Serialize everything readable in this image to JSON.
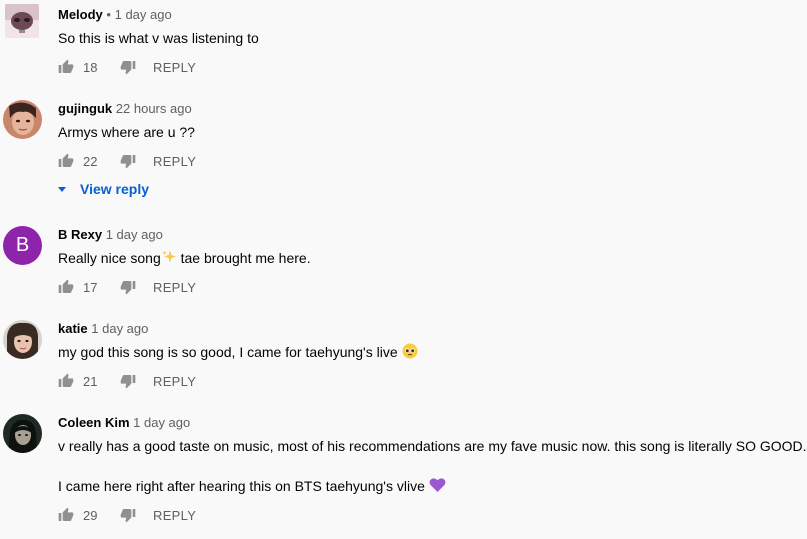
{
  "comments": [
    {
      "author": "Melody",
      "separator": "•",
      "time": "1 day ago",
      "text": [
        "So this is what v was listening to"
      ],
      "likes": "18",
      "reply_label": "REPLY"
    },
    {
      "author": "gujinguk",
      "time": "22 hours ago",
      "text": [
        "Armys where are u ??"
      ],
      "likes": "22",
      "reply_label": "REPLY",
      "view_reply_label": "View reply"
    },
    {
      "author": "B Rexy",
      "avatar_letter": "B",
      "avatar_color": "#8e24aa",
      "time": "1 day ago",
      "text_before": "Really nice song",
      "text_after": " tae brought me here.",
      "likes": "17",
      "reply_label": "REPLY"
    },
    {
      "author": "katie",
      "time": "1 day ago",
      "text": [
        "my god this song is so good, I came for taehyung's live"
      ],
      "likes": "21",
      "reply_label": "REPLY"
    },
    {
      "author": "Coleen Kim",
      "time": "1 day ago",
      "text": [
        "v really has a good taste on music, most of his recommendations are my fave music now. this song is literally SO GOOD.",
        "I came here right after hearing this on BTS taehyung's vlive"
      ],
      "likes": "29",
      "reply_label": "REPLY"
    }
  ],
  "colors": {
    "background": "#f9f9f9",
    "link_blue": "#065fd4",
    "secondary_text": "#606060"
  },
  "icons": [
    "thumbs-up-icon",
    "thumbs-down-icon",
    "caret-down-icon",
    "sparkles-emoji",
    "pleading-face-emoji",
    "purple-heart-emoji"
  ]
}
